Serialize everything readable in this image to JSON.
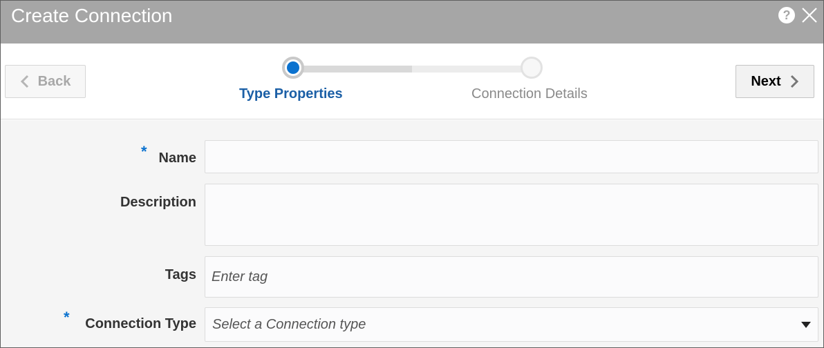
{
  "dialog": {
    "title": "Create Connection"
  },
  "train": {
    "back_label": "Back",
    "next_label": "Next",
    "steps": [
      {
        "label": "Type Properties",
        "state": "current"
      },
      {
        "label": "Connection Details",
        "state": "upcoming"
      }
    ]
  },
  "form": {
    "name": {
      "label": "Name",
      "required": "*",
      "value": ""
    },
    "description": {
      "label": "Description",
      "value": ""
    },
    "tags": {
      "label": "Tags",
      "placeholder": "Enter tag"
    },
    "connection_type": {
      "label": "Connection Type",
      "required": "*",
      "placeholder": "Select a Connection type"
    }
  },
  "colors": {
    "titlebar": "#a6a6a6",
    "accent": "#0b72cf",
    "current_step_text": "#1b5fa6"
  },
  "icons": [
    "help-icon",
    "close-icon",
    "chevron-left-icon",
    "chevron-right-icon",
    "caret-down-icon"
  ]
}
